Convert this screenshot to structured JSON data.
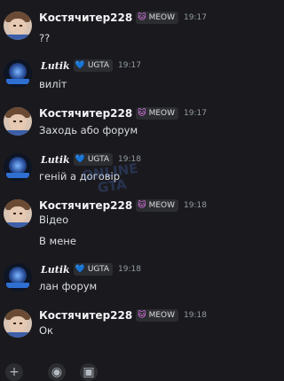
{
  "messages": [
    {
      "author": "Костячитер228",
      "badge": "MEOW",
      "time": "19:17",
      "lines": [
        "??"
      ]
    },
    {
      "author": "Lutik",
      "badge": "UGTA",
      "time": "19:17",
      "lines": [
        "виліт"
      ]
    },
    {
      "author": "Костячитер228",
      "badge": "MEOW",
      "time": "19:17",
      "lines": [
        "Заходь або форум"
      ]
    },
    {
      "author": "Lutik",
      "badge": "UGTA",
      "time": "19:18",
      "lines": [
        "геній а договір"
      ]
    },
    {
      "author": "Костячитер228",
      "badge": "MEOW",
      "time": "19:18",
      "lines": [
        "Відео",
        "В мене"
      ]
    },
    {
      "author": "Lutik",
      "badge": "UGTA",
      "time": "19:18",
      "lines": [
        "лан форум"
      ]
    },
    {
      "author": "Костячитер228",
      "badge": "MEOW",
      "time": "19:18",
      "lines": [
        "Ок"
      ]
    }
  ],
  "watermark": {
    "text": "ONLINE GTA"
  },
  "icons": {
    "meow_badge": "cat-icon",
    "ugta_badge": "heart-icon",
    "bottom": [
      "plus-icon",
      "apps-icon",
      "gift-icon"
    ]
  },
  "colors": {
    "background": "#1a1a1e",
    "text": "#dbdee1",
    "timestamp": "#949ba4",
    "meow": "#f47fff",
    "ugta": "#8fc7ff"
  }
}
